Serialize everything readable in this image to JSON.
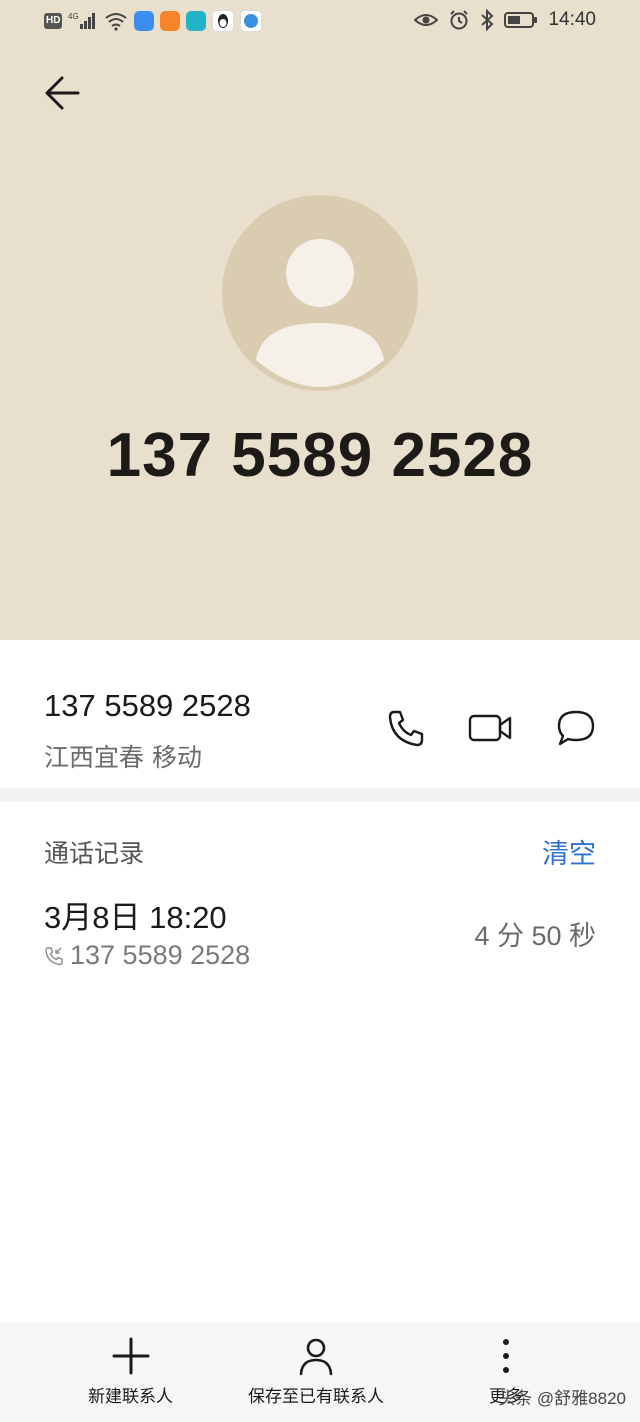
{
  "status_bar": {
    "left_icons": [
      "hd-icon",
      "4g-signal-icon",
      "wifi-icon",
      "cloud-app-icon",
      "video-app-icon",
      "reader-app-icon",
      "qq-app-icon",
      "browser-app-icon"
    ],
    "hd": "HD",
    "network": "4G",
    "time": "14:40"
  },
  "header": {
    "phone_number": "137 5589 2528",
    "background_color": "#e8dfcc",
    "avatar_color": "#d9ccb0"
  },
  "detail": {
    "number": "137 5589 2528",
    "location": "江西宜春 移动",
    "actions": [
      "phone-icon",
      "video-call-icon",
      "message-icon"
    ]
  },
  "call_log": {
    "title": "通话记录",
    "clear_label": "清空",
    "accent_color": "#2f72d1",
    "entries": [
      {
        "datetime": "3月8日 18:20",
        "number": "137 5589 2528",
        "duration": "4 分 50 秒"
      }
    ]
  },
  "bottom_bar": {
    "new_contact": "新建联系人",
    "save_to_existing": "保存至已有联系人",
    "more": "更多"
  },
  "watermark": "头条 @舒雅8820"
}
